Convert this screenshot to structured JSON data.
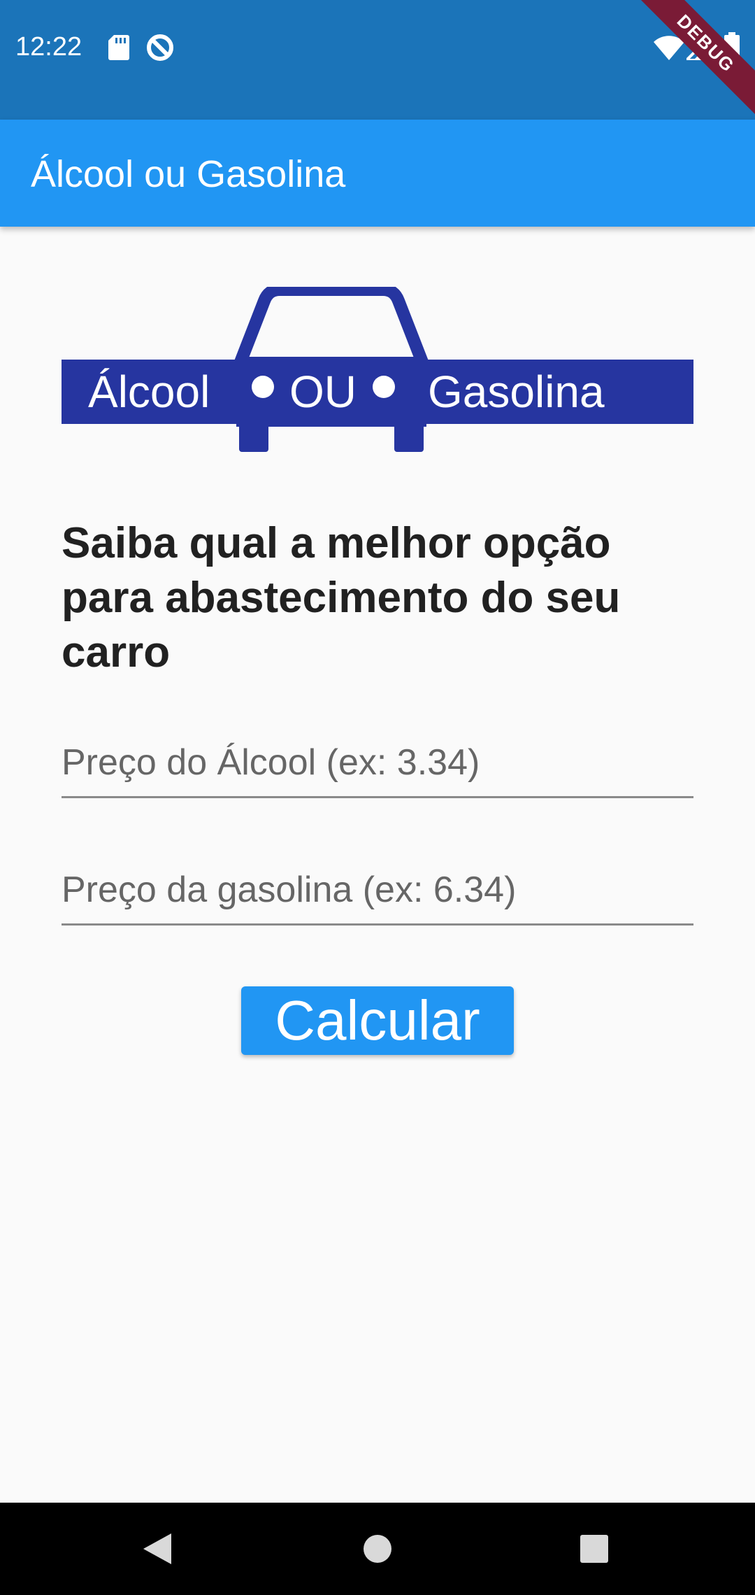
{
  "status_bar": {
    "time": "12:22",
    "debug_label": "DEBUG",
    "icons": [
      "sd-card-icon",
      "data-saver-icon",
      "wifi-icon",
      "signal-icon",
      "battery-icon"
    ]
  },
  "app_bar": {
    "title": "Álcool ou Gasolina"
  },
  "logo": {
    "left_word": "Álcool",
    "middle_word": "OU",
    "right_word": "Gasolina",
    "color": "#2635a0"
  },
  "main": {
    "headline": "Saiba qual a melhor opção para abastecimento do seu carro",
    "alcohol_field": {
      "value": "",
      "placeholder": "Preço do Álcool (ex: 3.34)"
    },
    "gasoline_field": {
      "value": "",
      "placeholder": "Preço da gasolina (ex: 6.34)"
    },
    "calculate_button": "Calcular"
  },
  "colors": {
    "status_bar": "#1b74b9",
    "app_bar": "#2196f3",
    "button": "#2196f3",
    "background": "#fafafa",
    "debug_banner": "#7a1b36"
  },
  "nav_bar": {
    "icons": [
      "back-icon",
      "home-icon",
      "recents-icon"
    ]
  }
}
